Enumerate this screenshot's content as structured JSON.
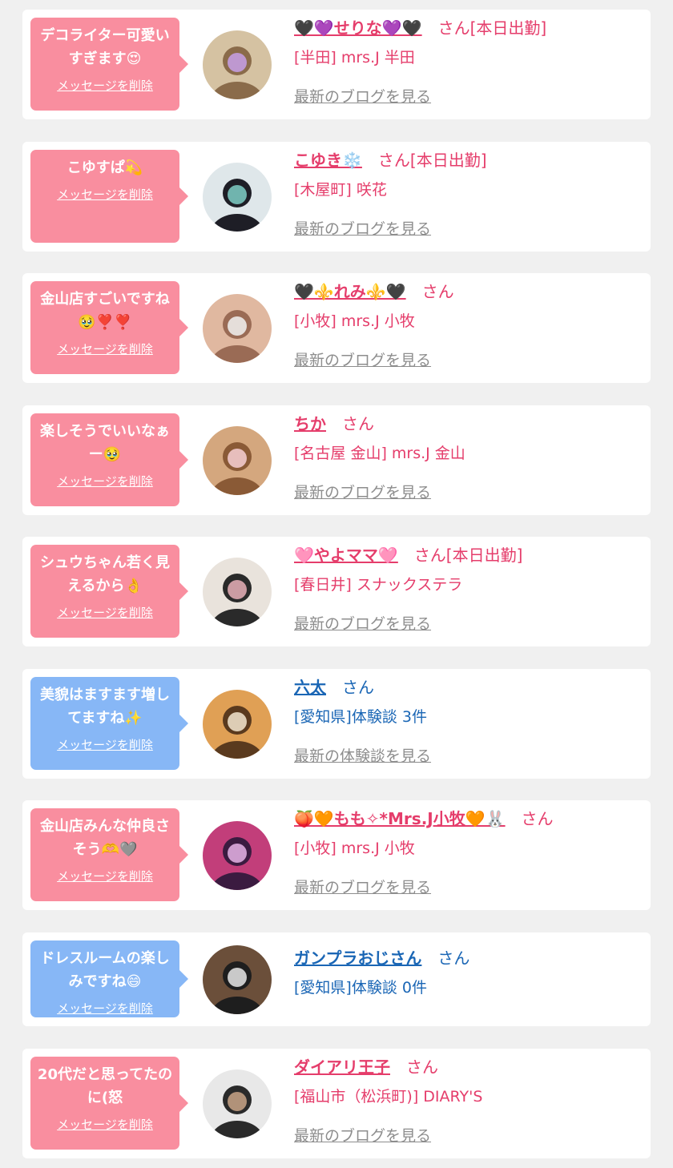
{
  "delete_label": "メッセージを削除",
  "colors": {
    "pink_bubble": "#f98e9f",
    "blue_bubble": "#87b7f6",
    "pink_text": "#e53d6b",
    "blue_text": "#1a66b5"
  },
  "items": [
    {
      "type": "pink",
      "message": "デコライター可愛いすぎます😍",
      "name": "🖤💜せりな💜🖤",
      "suffix": "さん[本日出勤]",
      "sub": "[半田] mrs.J 半田",
      "link": "最新のブログを見る",
      "avatar": "photo-avatar"
    },
    {
      "type": "pink",
      "message": "こゆすぱ💫",
      "name": "こゆき❄️",
      "suffix": "さん[本日出勤]",
      "sub": "[木屋町] 咲花",
      "link": "最新のブログを見る",
      "avatar": "photo-avatar"
    },
    {
      "type": "pink",
      "message": "金山店すごいですね🥹❣️❣️",
      "name": "🖤⚜️れみ⚜️🖤",
      "suffix": "さん",
      "sub": "[小牧] mrs.J 小牧",
      "link": "最新のブログを見る",
      "avatar": "photo-avatar"
    },
    {
      "type": "pink",
      "message": "楽しそうでいいなぁー🥹",
      "name": "ちか",
      "suffix": "さん",
      "sub": "[名古屋 金山] mrs.J 金山",
      "link": "最新のブログを見る",
      "avatar": "photo-avatar"
    },
    {
      "type": "pink",
      "message": "シュウちゃん若く見えるから👌",
      "name": "🩷やよママ🩷",
      "suffix": "さん[本日出勤]",
      "sub": "[春日井] スナックステラ",
      "link": "最新のブログを見る",
      "avatar": "photo-avatar"
    },
    {
      "type": "blue",
      "message": "美貌はますます増してますね✨",
      "name": "六太",
      "suffix": "さん",
      "sub": "[愛知県]体験談 3件",
      "link": "最新の体験談を見る",
      "avatar": "photo-avatar"
    },
    {
      "type": "pink",
      "message": "金山店みんな仲良さそう🫶🩶",
      "name": "🍑🧡もも✧*Mrs.J小牧🧡🐰",
      "suffix": "さん",
      "sub": "[小牧] mrs.J 小牧",
      "link": "最新のブログを見る",
      "avatar": "photo-avatar"
    },
    {
      "type": "blue",
      "message": "ドレスルームの楽しみですね😄",
      "name": "ガンプラおじさん",
      "suffix": "さん",
      "sub": "[愛知県]体験談 0件",
      "link": "",
      "avatar": "photo-avatar"
    },
    {
      "type": "pink",
      "message": "20代だと思ってたのに(怒",
      "name": "ダイアリ王子",
      "suffix": "さん",
      "sub": "[福山市（松浜町)] DIARY'S",
      "link": "最新のブログを見る",
      "avatar": "photo-avatar"
    }
  ]
}
